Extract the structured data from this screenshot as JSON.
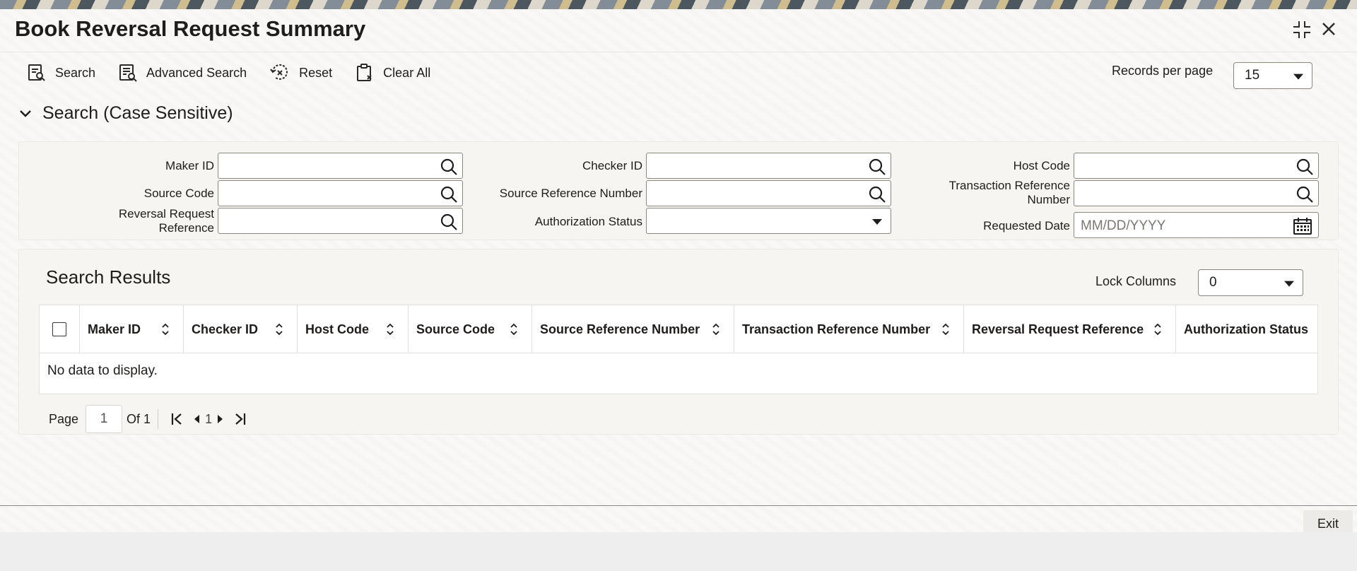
{
  "window": {
    "title": "Book Reversal Request Summary",
    "maximize_icon": "collapse-icon",
    "close_icon": "close-icon"
  },
  "toolbar": {
    "search_label": "Search",
    "advanced_search_label": "Advanced Search",
    "reset_label": "Reset",
    "clear_all_label": "Clear All",
    "records_per_page_label": "Records per page",
    "records_per_page_value": "15"
  },
  "search": {
    "section_title": "Search (Case Sensitive)",
    "maker_id_label": "Maker ID",
    "checker_id_label": "Checker ID",
    "host_code_label": "Host Code",
    "source_code_label": "Source Code",
    "source_reference_number_label": "Source Reference Number",
    "transaction_reference_number_label_1": "Transaction Reference",
    "transaction_reference_number_label_2": "Number",
    "reversal_request_reference_label_1": "Reversal Request",
    "reversal_request_reference_label_2": "Reference",
    "authorization_status_label": "Authorization Status",
    "requested_date_label": "Requested Date",
    "requested_date_placeholder": "MM/DD/YYYY"
  },
  "results": {
    "title": "Search Results",
    "lock_columns_label": "Lock Columns",
    "lock_columns_value": "0",
    "columns": [
      "Maker ID",
      "Checker ID",
      "Host Code",
      "Source Code",
      "Source Reference Number",
      "Transaction Reference Number",
      "Reversal Request Reference",
      "Authorization Status"
    ],
    "empty_message": "No data to display."
  },
  "pager": {
    "page_label": "Page",
    "current_page": "1",
    "of_label": "Of 1",
    "page_number": "1"
  },
  "footer": {
    "exit_label": "Exit"
  }
}
